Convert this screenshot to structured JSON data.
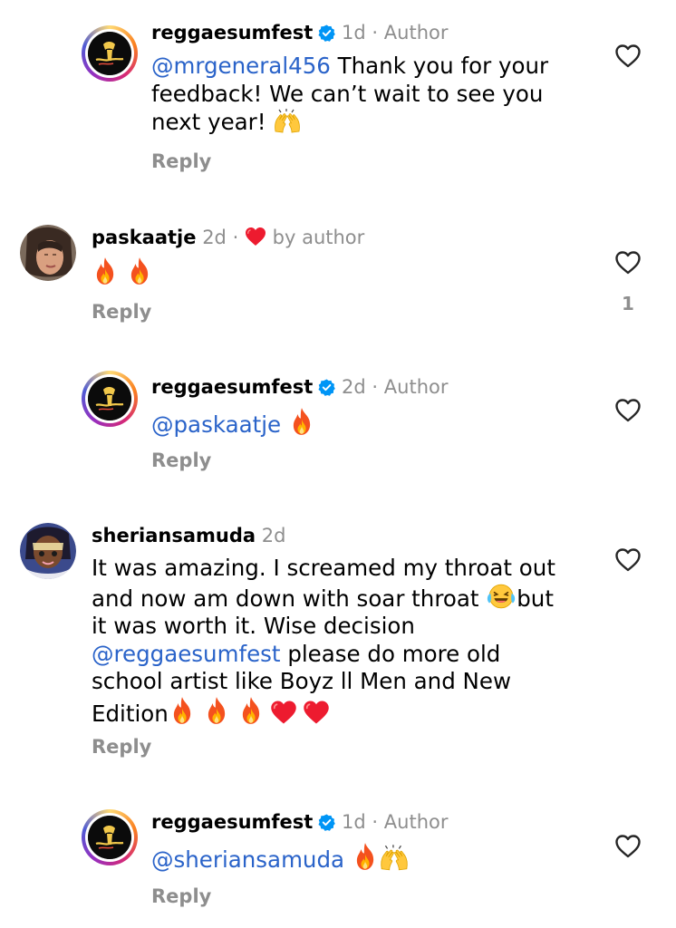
{
  "comments": [
    {
      "username": "reggaesumfest",
      "time": "1d",
      "tag": "Author",
      "mention": "@mrgeneral456",
      "text": " Thank you for your feedback! We can’t wait to see you next year!",
      "reply_label": "Reply",
      "emoji_icons": [
        "raised-hands-icon"
      ]
    },
    {
      "username": "paskaatje",
      "time": "2d",
      "liked_label": "by author",
      "reply_label": "Reply",
      "like_count": "1",
      "emoji_icons": [
        "fire-icon",
        "fire-icon"
      ]
    },
    {
      "username": "reggaesumfest",
      "time": "2d",
      "tag": "Author",
      "mention": "@paskaatje",
      "reply_label": "Reply",
      "emoji_icons": [
        "fire-icon"
      ]
    },
    {
      "username": "sheriansamuda",
      "time": "2d",
      "text_1": "It was amazing. I screamed my throat out",
      "text_2": "and now am down  with soar throat ",
      "text_2b": "but",
      "text_3": "it was worth it. Wise decision",
      "mention": "@reggaesumfest",
      "text_4": " please do more old",
      "text_5": "school artist like Boyz ll Men and New",
      "text_6": "Edition",
      "reply_label": "Reply",
      "emoji_icons": [
        "laughing-tears-icon",
        "fire-icon",
        "fire-icon",
        "fire-icon",
        "red-heart-icon",
        "red-heart-icon"
      ]
    },
    {
      "username": "reggaesumfest",
      "time": "1d",
      "tag": "Author",
      "mention": "@sheriansamuda",
      "reply_label": "Reply",
      "emoji_icons": [
        "fire-icon",
        "raised-hands-icon"
      ]
    }
  ],
  "colors": {
    "mention": "#2a63c9",
    "secondary_text": "#8e8e8e",
    "verified": "#0095f6",
    "liked_heart": "#ed1b2f"
  }
}
